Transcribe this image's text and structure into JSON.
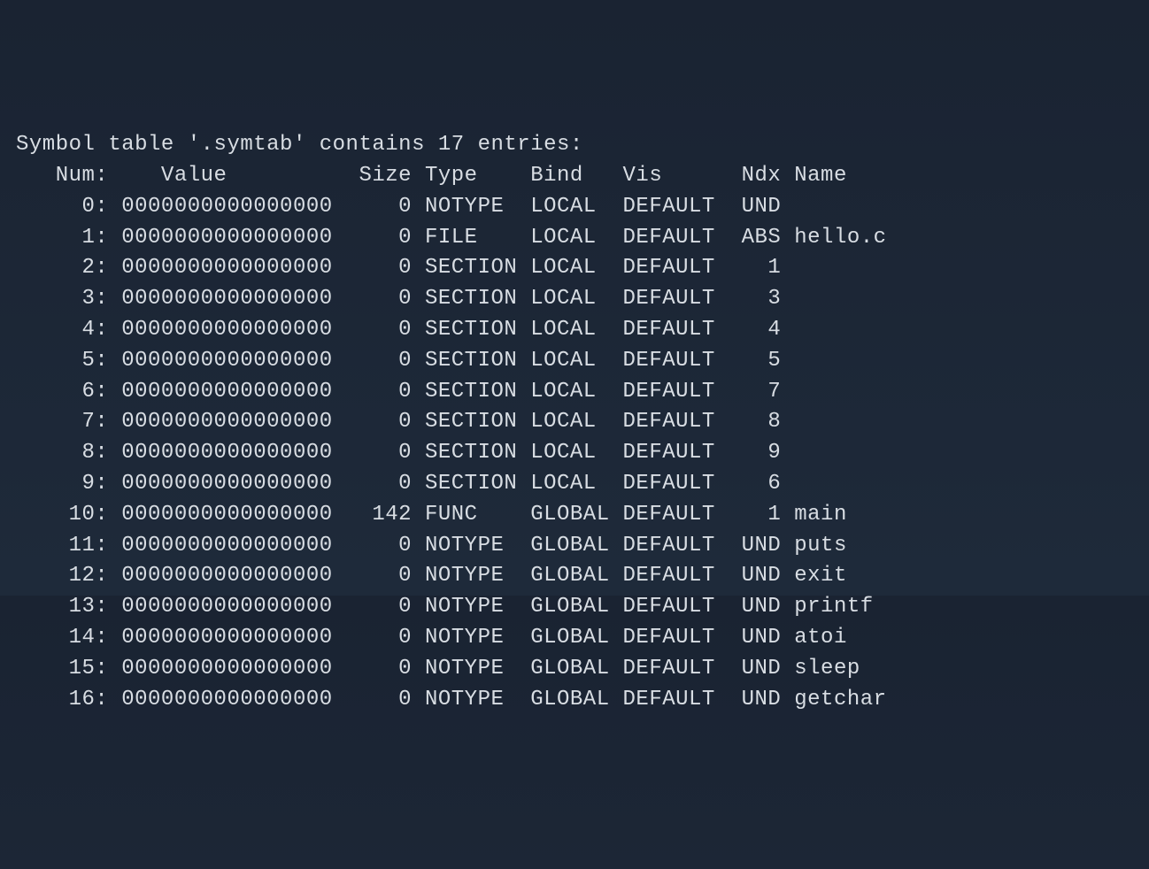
{
  "title": "Symbol table '.symtab' contains 17 entries:",
  "columns": {
    "num": "Num:",
    "value": "Value",
    "size": "Size",
    "type": "Type",
    "bind": "Bind",
    "vis": "Vis",
    "ndx": "Ndx",
    "name": "Name"
  },
  "rows": [
    {
      "num": "0:",
      "value": "0000000000000000",
      "size": "0",
      "type": "NOTYPE",
      "bind": "LOCAL",
      "vis": "DEFAULT",
      "ndx": "UND",
      "name": ""
    },
    {
      "num": "1:",
      "value": "0000000000000000",
      "size": "0",
      "type": "FILE",
      "bind": "LOCAL",
      "vis": "DEFAULT",
      "ndx": "ABS",
      "name": "hello.c"
    },
    {
      "num": "2:",
      "value": "0000000000000000",
      "size": "0",
      "type": "SECTION",
      "bind": "LOCAL",
      "vis": "DEFAULT",
      "ndx": "1",
      "name": ""
    },
    {
      "num": "3:",
      "value": "0000000000000000",
      "size": "0",
      "type": "SECTION",
      "bind": "LOCAL",
      "vis": "DEFAULT",
      "ndx": "3",
      "name": ""
    },
    {
      "num": "4:",
      "value": "0000000000000000",
      "size": "0",
      "type": "SECTION",
      "bind": "LOCAL",
      "vis": "DEFAULT",
      "ndx": "4",
      "name": ""
    },
    {
      "num": "5:",
      "value": "0000000000000000",
      "size": "0",
      "type": "SECTION",
      "bind": "LOCAL",
      "vis": "DEFAULT",
      "ndx": "5",
      "name": ""
    },
    {
      "num": "6:",
      "value": "0000000000000000",
      "size": "0",
      "type": "SECTION",
      "bind": "LOCAL",
      "vis": "DEFAULT",
      "ndx": "7",
      "name": ""
    },
    {
      "num": "7:",
      "value": "0000000000000000",
      "size": "0",
      "type": "SECTION",
      "bind": "LOCAL",
      "vis": "DEFAULT",
      "ndx": "8",
      "name": ""
    },
    {
      "num": "8:",
      "value": "0000000000000000",
      "size": "0",
      "type": "SECTION",
      "bind": "LOCAL",
      "vis": "DEFAULT",
      "ndx": "9",
      "name": ""
    },
    {
      "num": "9:",
      "value": "0000000000000000",
      "size": "0",
      "type": "SECTION",
      "bind": "LOCAL",
      "vis": "DEFAULT",
      "ndx": "6",
      "name": ""
    },
    {
      "num": "10:",
      "value": "0000000000000000",
      "size": "142",
      "type": "FUNC",
      "bind": "GLOBAL",
      "vis": "DEFAULT",
      "ndx": "1",
      "name": "main"
    },
    {
      "num": "11:",
      "value": "0000000000000000",
      "size": "0",
      "type": "NOTYPE",
      "bind": "GLOBAL",
      "vis": "DEFAULT",
      "ndx": "UND",
      "name": "puts"
    },
    {
      "num": "12:",
      "value": "0000000000000000",
      "size": "0",
      "type": "NOTYPE",
      "bind": "GLOBAL",
      "vis": "DEFAULT",
      "ndx": "UND",
      "name": "exit"
    },
    {
      "num": "13:",
      "value": "0000000000000000",
      "size": "0",
      "type": "NOTYPE",
      "bind": "GLOBAL",
      "vis": "DEFAULT",
      "ndx": "UND",
      "name": "printf"
    },
    {
      "num": "14:",
      "value": "0000000000000000",
      "size": "0",
      "type": "NOTYPE",
      "bind": "GLOBAL",
      "vis": "DEFAULT",
      "ndx": "UND",
      "name": "atoi"
    },
    {
      "num": "15:",
      "value": "0000000000000000",
      "size": "0",
      "type": "NOTYPE",
      "bind": "GLOBAL",
      "vis": "DEFAULT",
      "ndx": "UND",
      "name": "sleep"
    },
    {
      "num": "16:",
      "value": "0000000000000000",
      "size": "0",
      "type": "NOTYPE",
      "bind": "GLOBAL",
      "vis": "DEFAULT",
      "ndx": "UND",
      "name": "getchar"
    }
  ]
}
